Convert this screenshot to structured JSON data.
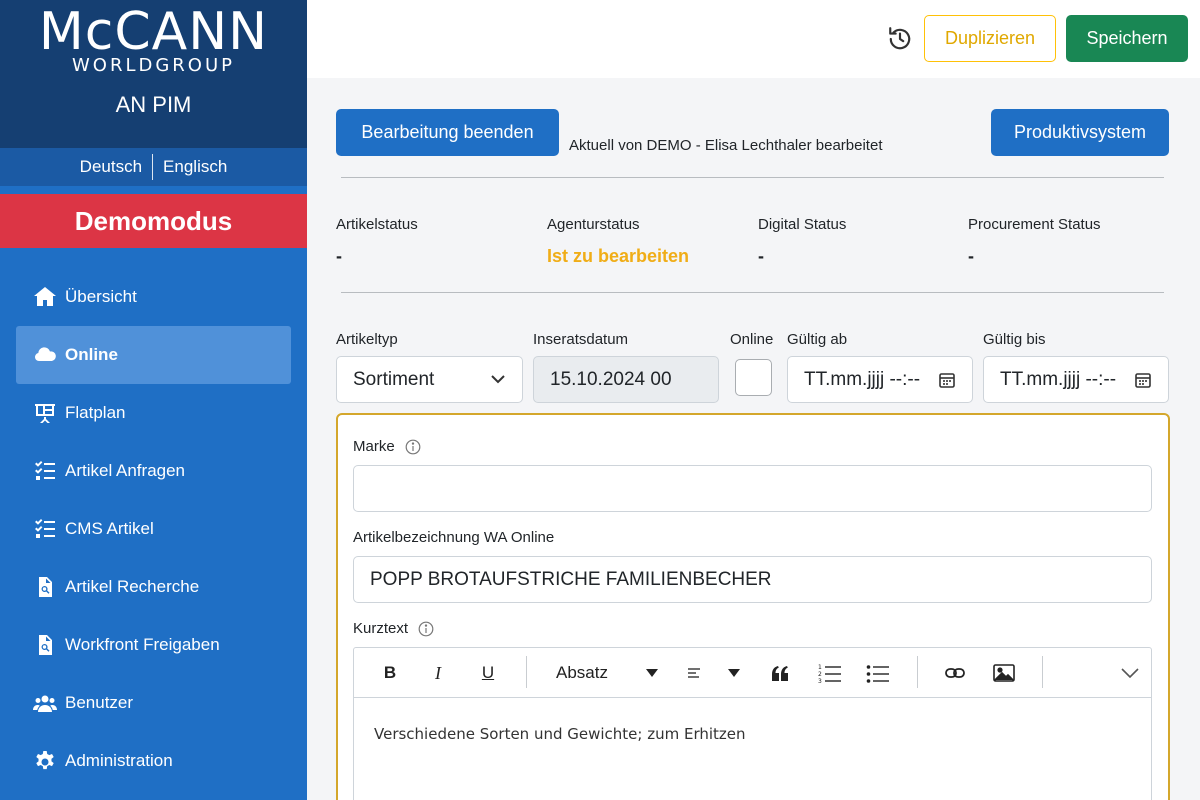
{
  "sidebar": {
    "logo_main": "McCANN",
    "logo_sub": "WORLDGROUP",
    "app_name": "AN PIM",
    "languages": [
      "Deutsch",
      "Englisch"
    ],
    "demo_label": "Demomodus",
    "items": [
      {
        "label": "Übersicht",
        "icon": "home-icon"
      },
      {
        "label": "Online",
        "icon": "cloud-icon",
        "active": true
      },
      {
        "label": "Flatplan",
        "icon": "presentation-icon"
      },
      {
        "label": "Artikel Anfragen",
        "icon": "list-check-icon"
      },
      {
        "label": "CMS Artikel",
        "icon": "list-check-icon"
      },
      {
        "label": "Artikel Recherche",
        "icon": "file-search-icon"
      },
      {
        "label": "Workfront Freigaben",
        "icon": "file-search-icon"
      },
      {
        "label": "Benutzer",
        "icon": "users-icon"
      },
      {
        "label": "Administration",
        "icon": "gear-icon"
      }
    ]
  },
  "topbar": {
    "duplicate_label": "Duplizieren",
    "save_label": "Speichern"
  },
  "main": {
    "end_edit_label": "Bearbeitung beenden",
    "edit_info": "Aktuell von DEMO - Elisa Lechthaler bearbeitet",
    "prod_system_label": "Produktivsystem",
    "statuses": [
      {
        "label": "Artikelstatus",
        "value": "-"
      },
      {
        "label": "Agenturstatus",
        "value": "Ist zu bearbeiten"
      },
      {
        "label": "Digital Status",
        "value": "-"
      },
      {
        "label": "Procurement Status",
        "value": "-"
      }
    ],
    "fields": {
      "artikeltyp_label": "Artikeltyp",
      "artikeltyp_value": "Sortiment",
      "inseratsdatum_label": "Inseratsdatum",
      "inseratsdatum_value": "15.10.2024 00",
      "online_label": "Online",
      "gueltig_ab_label": "Gültig ab",
      "gueltig_ab_placeholder": "TT.mm.jjjj --:--",
      "gueltig_bis_label": "Gültig bis",
      "gueltig_bis_placeholder": "TT.mm.jjjj --:--"
    },
    "card": {
      "marke_label": "Marke",
      "marke_value": "",
      "bezeichnung_label": "Artikelbezeichnung WA Online",
      "bezeichnung_value": "POPP BROTAUFSTRICHE FAMILIENBECHER",
      "kurztext_label": "Kurztext",
      "editor": {
        "bold": "B",
        "italic": "I",
        "underline": "U",
        "paragraph_label": "Absatz",
        "content": "Verschiedene Sorten und Gewichte; zum Erhitzen"
      }
    }
  },
  "colors": {
    "sidebar": "#1f6fc5",
    "brand": "#153f72",
    "demo": "#dc3545",
    "save": "#198754",
    "warning": "#ffc107"
  }
}
